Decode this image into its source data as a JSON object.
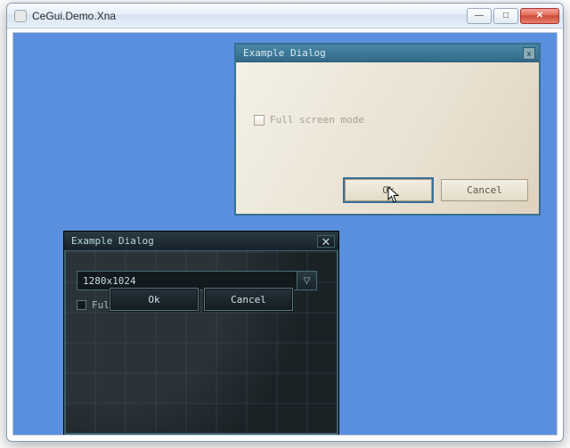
{
  "window": {
    "title": "CeGui.Demo.Xna",
    "minimize_glyph": "—",
    "maximize_glyph": "□",
    "close_glyph": "✕"
  },
  "dialog_light": {
    "title": "Example Dialog",
    "close_glyph": "x",
    "fullscreen_label": "Full screen mode",
    "ok_label": "Ok",
    "cancel_label": "Cancel",
    "fullscreen_checked": false
  },
  "dialog_dark": {
    "title": "Example Dialog",
    "close_glyph": "✕",
    "resolution_value": "1280x1024",
    "dropdown_glyph": "▽",
    "fullscreen_label": "Full screen mode",
    "ok_label": "Ok",
    "cancel_label": "Cancel",
    "fullscreen_checked": false
  },
  "colors": {
    "client_bg": "#5a8fde",
    "light_titlebar": "#3a6f8f",
    "dark_accent": "#4a6c76"
  }
}
